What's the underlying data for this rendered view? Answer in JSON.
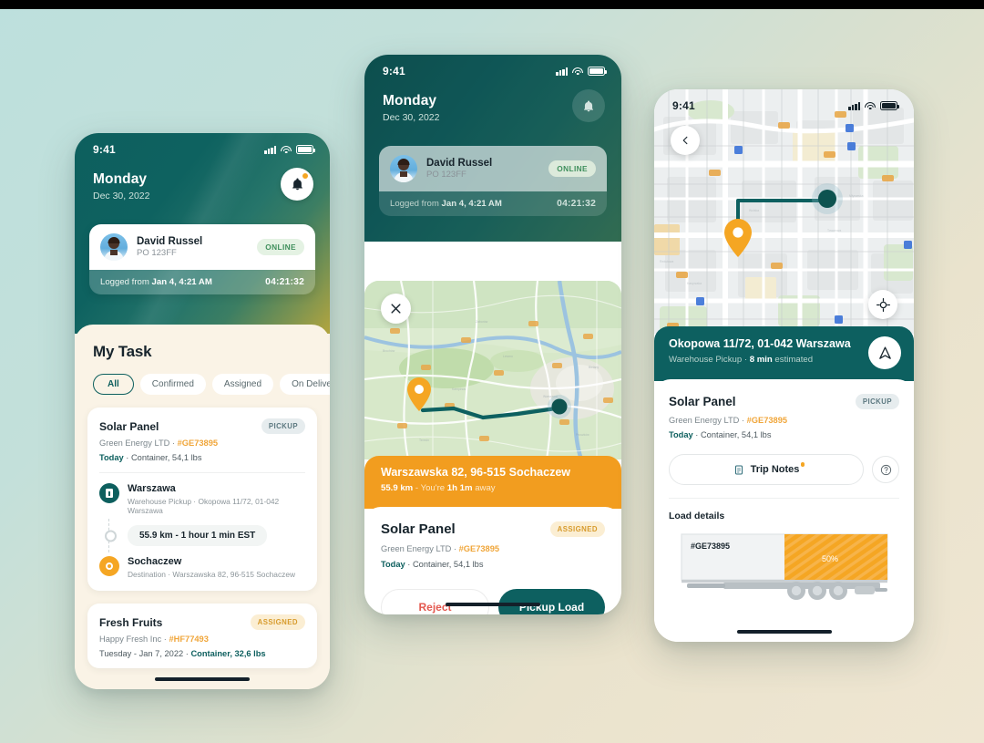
{
  "phone1": {
    "status": {
      "time": "9:41"
    },
    "header": {
      "day": "Monday",
      "date": "Dec 30, 2022",
      "bell_icon": "bell-icon"
    },
    "user_card": {
      "name": "David Russel",
      "po": "PO 123FF",
      "status_badge": "ONLINE",
      "logged_prefix": "Logged from ",
      "logged_time": "Jan 4, 4:21 AM",
      "timer": "04:21:32"
    },
    "section_title": "My Task",
    "filters": [
      {
        "label": "All",
        "selected": true
      },
      {
        "label": "Confirmed",
        "selected": false
      },
      {
        "label": "Assigned",
        "selected": false
      },
      {
        "label": "On Delivery",
        "selected": false
      }
    ],
    "task1": {
      "title": "Solar Panel",
      "company": "Green Energy LTD",
      "ref": "#GE73895",
      "when": "Today",
      "meta": "Container, 54,1 lbs",
      "badge": "PICKUP",
      "origin": {
        "name": "Warszawa",
        "type": "Warehouse Pickup",
        "address": "Okopowa 11/72, 01-042 Warszawa"
      },
      "estimate": "55.9 km - 1 hour 1 min EST",
      "dest": {
        "name": "Sochaczew",
        "type": "Destination",
        "address": "Warszawska 82, 96-515 Sochaczew"
      }
    },
    "task2": {
      "title": "Fresh Fruits",
      "company": "Happy Fresh Inc",
      "ref": "#HF77493",
      "when": "Tuesday - Jan 7, 2022",
      "meta": "Container, 32,6 lbs",
      "badge": "ASSIGNED"
    }
  },
  "phone2": {
    "status": {
      "time": "9:41"
    },
    "header": {
      "day": "Monday",
      "date": "Dec 30, 2022",
      "bell_icon": "bell-icon"
    },
    "user_card": {
      "name": "David Russel",
      "po": "PO 123FF",
      "status_badge": "ONLINE",
      "logged_prefix": "Logged from ",
      "logged_time": "Jan 4, 4:21 AM",
      "timer": "04:21:32"
    },
    "map": {
      "close_icon": "close-icon",
      "origin_marker": "pin-marker-orange",
      "dest_marker": "dot-marker-teal"
    },
    "banner": {
      "address": "Warszawska 82, 96-515 Sochaczew",
      "distance": "55.9 km",
      "sep": " - You're ",
      "eta": "1h 1m",
      "away": " away"
    },
    "detail": {
      "title": "Solar Panel",
      "company": "Green Energy LTD",
      "ref": "#GE73895",
      "when": "Today",
      "meta": "Container, 54,1 lbs",
      "badge": "ASSIGNED"
    },
    "actions": {
      "reject": "Reject",
      "primary": "Pickup Load"
    }
  },
  "phone3": {
    "status": {
      "time": "9:41"
    },
    "map": {
      "back_icon": "chevron-left-icon",
      "locate_icon": "locate-icon",
      "origin_marker": "pin-marker-orange",
      "dest_marker": "dot-marker-teal"
    },
    "banner": {
      "address": "Okopowa 11/72, 01-042 Warszawa",
      "type": "Warehouse Pickup",
      "sep": " · ",
      "eta": "8 min",
      "eta_suffix": " estimated",
      "nav_icon": "navigate-icon"
    },
    "detail": {
      "title": "Solar Panel",
      "company": "Green Energy LTD",
      "ref": "#GE73895",
      "when": "Today",
      "meta": "Container, 54,1 lbs",
      "badge": "PICKUP"
    },
    "notes_button": "Trip Notes",
    "help_icon": "question-mark-icon",
    "load_details_label": "Load details",
    "truck": {
      "ref": "#GE73895",
      "fill_label": "50%",
      "fill_percent": 50
    }
  },
  "colors": {
    "teal": "#0d6060",
    "orange": "#f29d1f",
    "cream": "#faf3e6",
    "red": "#e4584f",
    "ref_orange": "#f0a63a"
  }
}
